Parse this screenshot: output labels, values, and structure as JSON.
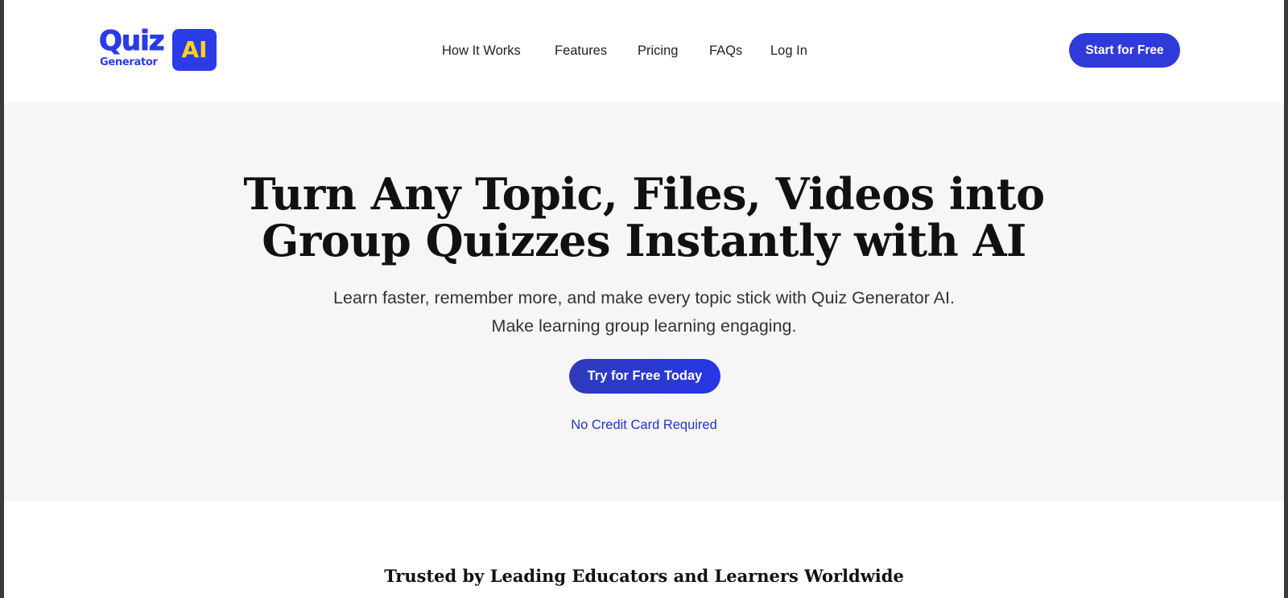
{
  "logo": {
    "quiz": "Quiz",
    "generator": "Generator",
    "ai": "AI"
  },
  "nav": {
    "items": [
      {
        "label": "How It Works"
      },
      {
        "label": "Features"
      },
      {
        "label": "Pricing"
      },
      {
        "label": "FAQs"
      },
      {
        "label": "Log In"
      }
    ],
    "cta": "Start for Free"
  },
  "hero": {
    "title_line1": "Turn Any Topic, Files, Videos into",
    "title_line2": "Group Quizzes Instantly with AI",
    "subtitle_line1": "Learn faster, remember more, and make every topic stick with Quiz Generator AI.",
    "subtitle_line2": "Make learning group learning engaging.",
    "cta": "Try for Free Today",
    "note": "No Credit Card Required"
  },
  "trusted": {
    "heading": "Trusted by Leading Educators and Learners Worldwide"
  },
  "colors": {
    "brand_blue": "#2a3ce8",
    "brand_yellow": "#ffd21f",
    "hero_bg": "#f6f6f6",
    "link_blue": "#2136c7"
  }
}
